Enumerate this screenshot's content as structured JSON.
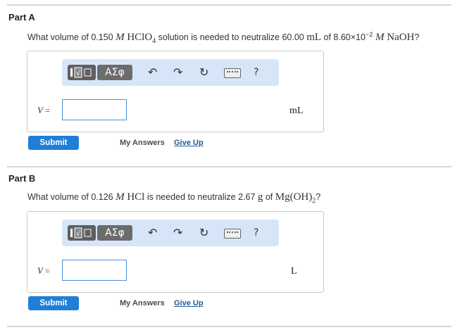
{
  "partA": {
    "title": "Part A",
    "question_prefix": "What volume of 0.150 ",
    "q_M1": "M",
    "q_formula1": " HClO",
    "q_sub1": "4",
    "q_mid": " solution is needed to neutralize 60.00 ",
    "q_unit1": "mL",
    "q_mid2": " of 8.60×10",
    "q_exp": "−2",
    "q_M2": " M",
    "q_formula2": " NaOH",
    "q_end": "?",
    "var_label": "V",
    "equals": " =",
    "input_value": "",
    "unit": "mL",
    "submit_label": "Submit",
    "my_answers_label": "My Answers",
    "give_up_label": "Give Up"
  },
  "partB": {
    "title": "Part B",
    "question_prefix": "What volume of 0.126 ",
    "q_M1": "M",
    "q_formula1": " HCl",
    "q_mid": " is needed to neutralize 2.67 ",
    "q_unit1": "g",
    "q_mid2": " of ",
    "q_formula2": "Mg(OH)",
    "q_sub2": "2",
    "q_end": "?",
    "var_label": "V",
    "equals": " =",
    "input_value": "",
    "unit": "L",
    "submit_label": "Submit",
    "my_answers_label": "My Answers",
    "give_up_label": "Give Up"
  },
  "toolbar": {
    "greek_label": "ΑΣφ",
    "undo_glyph": "↶",
    "redo_glyph": "↷",
    "reset_glyph": "↻",
    "help_glyph": "?",
    "icons": [
      "templates-icon",
      "greek-icon",
      "undo-icon",
      "redo-icon",
      "reset-icon",
      "keyboard-icon",
      "help-icon"
    ]
  },
  "colors": {
    "accent": "#1f7ed6",
    "toolbar_bg": "#d6e6f8",
    "link": "#1d5d9a",
    "input_border": "#4a90d9"
  }
}
